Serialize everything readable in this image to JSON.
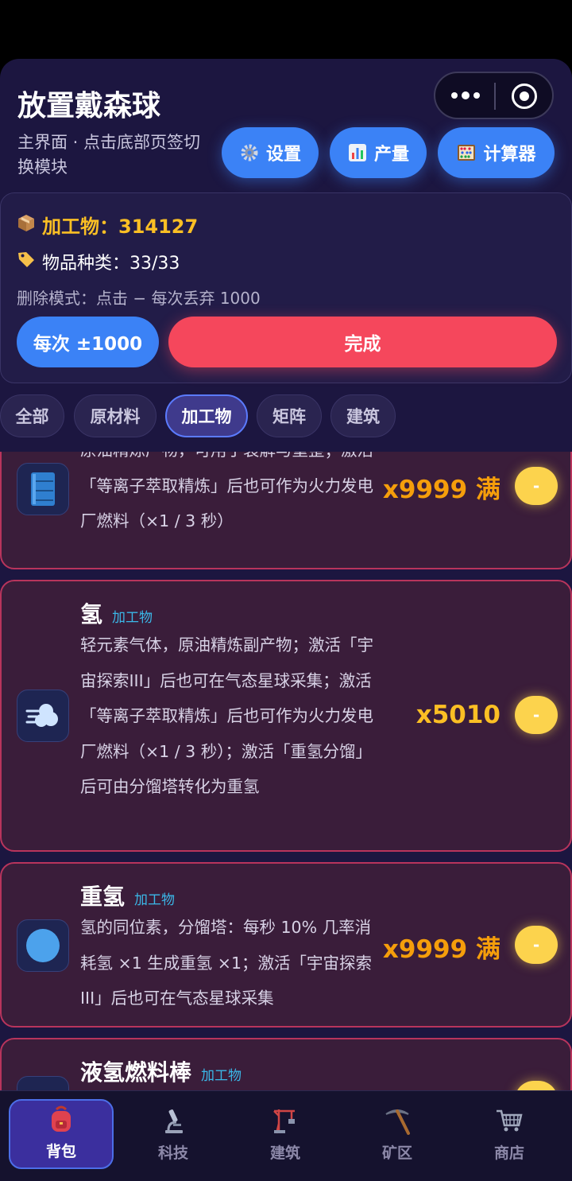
{
  "header": {
    "title": "放置戴森球",
    "subtitle": "主界面 · 点击底部页签切换模块",
    "buttons": [
      {
        "label": "设置",
        "icon": "gear-icon"
      },
      {
        "label": "产量",
        "icon": "bar-chart-icon"
      },
      {
        "label": "计算器",
        "icon": "abacus-icon"
      }
    ]
  },
  "panel": {
    "processed_label": "加工物：314127",
    "types_label": "物品种类：33/33",
    "mode_text": "删除模式：点击 − 每次丢弃 1000",
    "step_button": "每次 ±1000",
    "done_button": "完成"
  },
  "tabs": [
    "全部",
    "原材料",
    "加工物",
    "矩阵",
    "建筑"
  ],
  "active_tab": "加工物",
  "items": [
    {
      "name": "",
      "tag": "",
      "icon": "fuel-barrel-icon",
      "desc": "原油精炼产物，可用于裂解与重整；激活「等离子萃取精炼」后也可作为火力发电厂燃料（×1 / 3 秒）",
      "count": "x9999 满",
      "minus": "-"
    },
    {
      "name": "氢",
      "tag": "加工物",
      "icon": "gas-cloud-icon",
      "desc": "轻元素气体，原油精炼副产物；激活「宇宙探索III」后也可在气态星球采集；激活「等离子萃取精炼」后也可作为火力发电厂燃料（×1 / 3 秒）；激活「重氢分馏」后可由分馏塔转化为重氢",
      "count": "x5010",
      "minus": "-"
    },
    {
      "name": "重氢",
      "tag": "加工物",
      "icon": "blue-orb-icon",
      "desc": "氢的同位素，分馏塔：每秒 10% 几率消耗氢 ×1 生成重氢 ×1；激活「宇宙探索III」后也可在气态星球采集",
      "count": "x9999 满",
      "minus": "-"
    },
    {
      "name": "液氢燃料棒",
      "tag": "加工物",
      "icon": "fuel-rod-icon",
      "desc": "",
      "count": "",
      "minus": ""
    }
  ],
  "nav": [
    {
      "label": "背包",
      "icon": "backpack-icon"
    },
    {
      "label": "科技",
      "icon": "microscope-icon"
    },
    {
      "label": "建筑",
      "icon": "crane-icon"
    },
    {
      "label": "矿区",
      "icon": "pickaxe-icon"
    },
    {
      "label": "商店",
      "icon": "cart-icon"
    }
  ],
  "active_nav": "背包"
}
